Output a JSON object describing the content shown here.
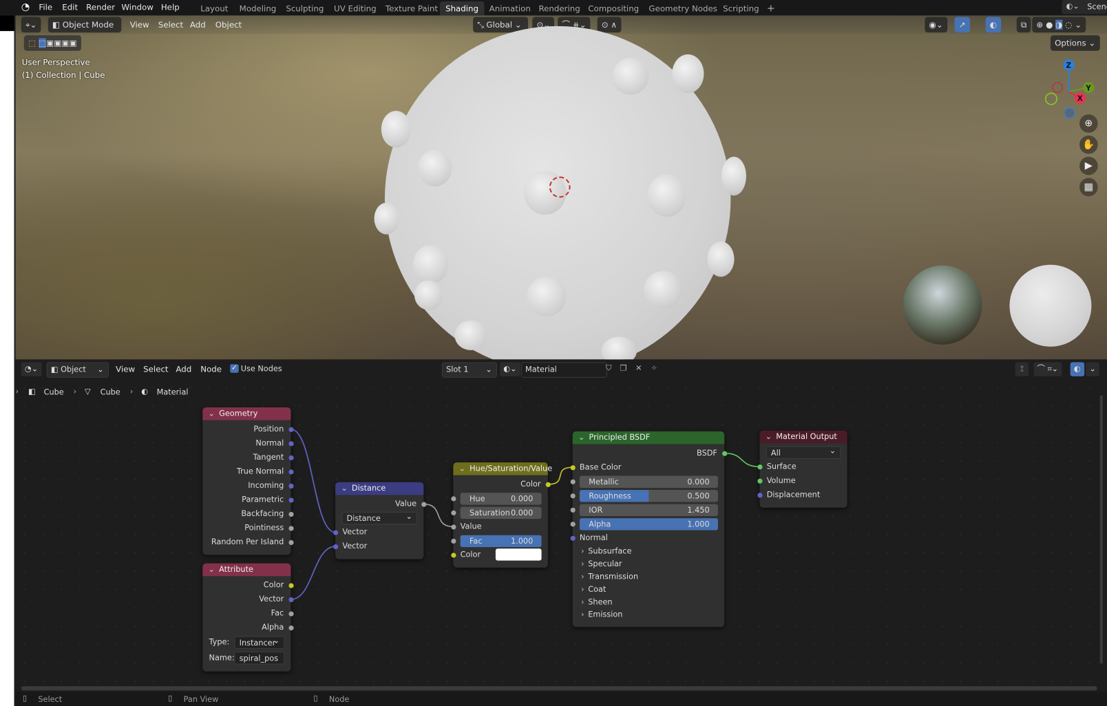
{
  "topbar": {
    "menus": [
      "File",
      "Edit",
      "Render",
      "Window",
      "Help"
    ],
    "workspaces": [
      "Layout",
      "Modeling",
      "Sculpting",
      "UV Editing",
      "Texture Paint",
      "Shading",
      "Animation",
      "Rendering",
      "Compositing",
      "Geometry Nodes",
      "Scripting"
    ],
    "active_workspace": "Shading",
    "add_tab": "+",
    "scene": "Scene"
  },
  "viewport": {
    "mode": "Object Mode",
    "menus": [
      "View",
      "Select",
      "Add",
      "Object"
    ],
    "orientation": "Global",
    "options": "Options",
    "overlay_line1": "User Perspective",
    "overlay_line2": "(1) Collection | Cube",
    "gizmo": {
      "z": "Z",
      "y": "Y",
      "x": "X"
    }
  },
  "node_editor": {
    "object_label": "Object",
    "menus": [
      "View",
      "Select",
      "Add",
      "Node"
    ],
    "use_nodes": "Use Nodes",
    "use_nodes_checked": true,
    "slot": "Slot 1",
    "material": "Material",
    "breadcrumb": [
      "Cube",
      "Cube",
      "Material"
    ],
    "nodes": [
      {
        "title": "Geometry",
        "color": "#83314a",
        "rows": [
          {
            "t": "out",
            "label": "Position",
            "s": "vector"
          },
          {
            "t": "out",
            "label": "Normal",
            "s": "vector"
          },
          {
            "t": "out",
            "label": "Tangent",
            "s": "vector"
          },
          {
            "t": "out",
            "label": "True Normal",
            "s": "vector"
          },
          {
            "t": "out",
            "label": "Incoming",
            "s": "vector"
          },
          {
            "t": "out",
            "label": "Parametric",
            "s": "vector"
          },
          {
            "t": "out",
            "label": "Backfacing",
            "s": "float"
          },
          {
            "t": "out",
            "label": "Pointiness",
            "s": "float"
          },
          {
            "t": "out",
            "label": "Random Per Island",
            "s": "float"
          }
        ]
      },
      {
        "title": "Attribute",
        "color": "#83314a",
        "rows": [
          {
            "t": "out",
            "label": "Color",
            "s": "color"
          },
          {
            "t": "out",
            "label": "Vector",
            "s": "vector"
          },
          {
            "t": "out",
            "label": "Fac",
            "s": "float"
          },
          {
            "t": "out",
            "label": "Alpha",
            "s": "float"
          },
          {
            "t": "prop",
            "label": "Type:",
            "value": "Instancer",
            "dd": true
          },
          {
            "t": "prop",
            "label": "Name:",
            "value": "spiral_pos"
          }
        ]
      },
      {
        "title": "Distance",
        "color": "#3c3c83",
        "rows": [
          {
            "t": "out",
            "label": "Value",
            "s": "float"
          },
          {
            "t": "dd",
            "value": "Distance"
          },
          {
            "t": "in",
            "label": "Vector",
            "s": "vector"
          },
          {
            "t": "in",
            "label": "Vector",
            "s": "vector"
          }
        ]
      },
      {
        "title": "Hue/Saturation/Value",
        "color": "#6e6e1d",
        "rows": [
          {
            "t": "out",
            "label": "Color",
            "s": "color"
          },
          {
            "t": "field",
            "label": "Hue",
            "value": "0.000",
            "s": "float"
          },
          {
            "t": "field",
            "label": "Saturation",
            "value": "0.000",
            "s": "float"
          },
          {
            "t": "in",
            "label": "Value",
            "s": "float"
          },
          {
            "t": "field",
            "label": "Fac",
            "value": "1.000",
            "fill": 1.0,
            "s": "float"
          },
          {
            "t": "colorin",
            "label": "Color",
            "swatch": "#ffffff",
            "s": "color"
          }
        ]
      },
      {
        "title": "Principled BSDF",
        "color": "#2b652b",
        "rows": [
          {
            "t": "out",
            "label": "BSDF",
            "s": "shader"
          },
          {
            "t": "in",
            "label": "Base Color",
            "s": "color"
          },
          {
            "t": "field",
            "label": "Metallic",
            "value": "0.000",
            "s": "float"
          },
          {
            "t": "field",
            "label": "Roughness",
            "value": "0.500",
            "fill": 0.5,
            "s": "float"
          },
          {
            "t": "field",
            "label": "IOR",
            "value": "1.450",
            "s": "float"
          },
          {
            "t": "field",
            "label": "Alpha",
            "value": "1.000",
            "fill": 1.0,
            "s": "float"
          },
          {
            "t": "in",
            "label": "Normal",
            "s": "vector"
          },
          {
            "t": "panel",
            "label": "Subsurface"
          },
          {
            "t": "panel",
            "label": "Specular"
          },
          {
            "t": "panel",
            "label": "Transmission"
          },
          {
            "t": "panel",
            "label": "Coat"
          },
          {
            "t": "panel",
            "label": "Sheen"
          },
          {
            "t": "panel",
            "label": "Emission"
          }
        ]
      },
      {
        "title": "Material Output",
        "color": "#4a1c27",
        "rows": [
          {
            "t": "dd",
            "value": "All"
          },
          {
            "t": "in",
            "label": "Surface",
            "s": "shader"
          },
          {
            "t": "in",
            "label": "Volume",
            "s": "shader"
          },
          {
            "t": "in",
            "label": "Displacement",
            "s": "vector"
          }
        ]
      }
    ]
  },
  "socket_colors": {
    "vector": "#6363c7",
    "float": "#a1a1a1",
    "color": "#c7c729",
    "shader": "#63c763"
  },
  "statusbar": {
    "items": [
      "Select",
      "Pan View",
      "Node"
    ]
  }
}
